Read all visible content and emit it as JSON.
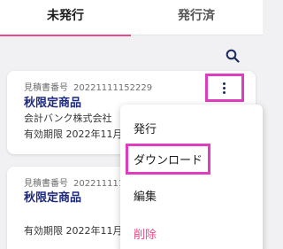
{
  "tabs": [
    {
      "label": "未発行"
    },
    {
      "label": "発行済"
    }
  ],
  "search": {
    "icon": "search-icon"
  },
  "cards": [
    {
      "estimate_label": "見積書番号",
      "estimate_number": "20221111152229",
      "title": "秋限定商品",
      "company": "会計バンク株式会社",
      "expiry": "有効期限 2022年11月"
    },
    {
      "estimate_label": "見積書番号",
      "estimate_number": "2022111115",
      "title": "秋限定商品",
      "company": "",
      "expiry": "有効期限 2022年11月"
    }
  ],
  "menu": {
    "items": [
      {
        "label": "発行"
      },
      {
        "label": "ダウンロード"
      },
      {
        "label": "編集"
      },
      {
        "label": "削除"
      }
    ]
  },
  "colors": {
    "accent": "#e84a8a",
    "highlight": "#e03cc0",
    "title": "#1e2a78"
  }
}
